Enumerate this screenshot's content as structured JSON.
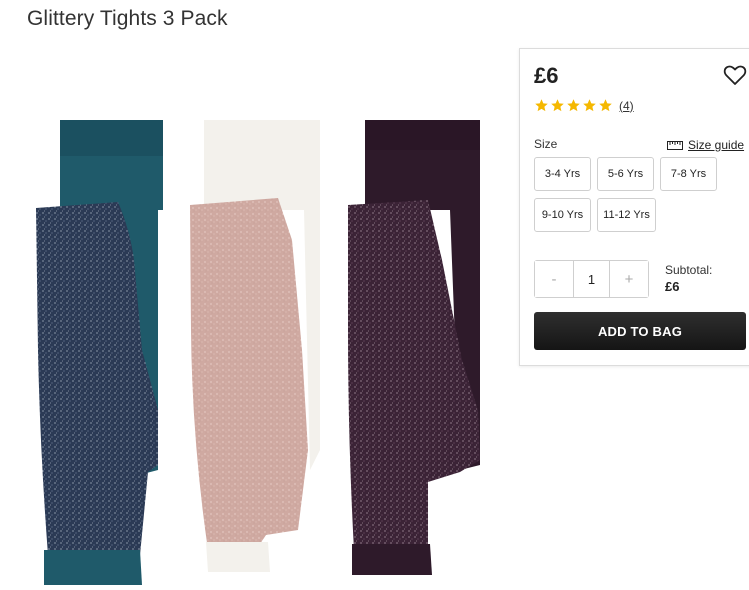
{
  "product": {
    "title": "Glittery Tights 3 Pack"
  },
  "panel": {
    "price": "£6",
    "rating": 5,
    "review_count": "(4)",
    "size_label": "Size",
    "size_guide_label": "Size guide",
    "sizes": [
      "3-4 Yrs",
      "5-6 Yrs",
      "7-8 Yrs",
      "9-10 Yrs",
      "11-12 Yrs"
    ],
    "quantity": "1",
    "qty_minus": "-",
    "qty_plus": "+",
    "subtotal_label": "Subtotal:",
    "subtotal_value": "£6",
    "add_to_bag_label": "ADD TO BAG"
  },
  "colors": {
    "star": "#f5b800",
    "button_dark": "#1c1c1c",
    "tights": [
      "#1f5a6a",
      "#f3f1ec",
      "#2e1a2a"
    ]
  }
}
